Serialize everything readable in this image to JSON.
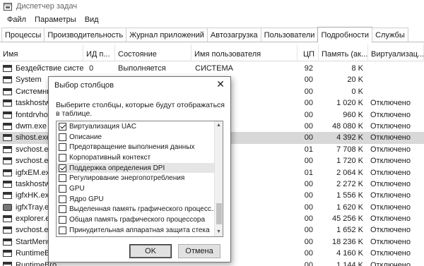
{
  "window": {
    "title": "Диспетчер задач"
  },
  "menu": [
    "Файл",
    "Параметры",
    "Вид"
  ],
  "tabs": [
    "Процессы",
    "Производительность",
    "Журнал приложений",
    "Автозагрузка",
    "Пользователи",
    "Подробности",
    "Службы"
  ],
  "active_tab": "Подробности",
  "columns": {
    "name": "Имя",
    "pid": "ИД п...",
    "status": "Состояние",
    "user": "Имя пользователя",
    "cpu": "ЦП",
    "memory": "Память (ак...",
    "virtualization": "Виртуализац..."
  },
  "rows": [
    {
      "name": "Бездействие системы",
      "pid": "0",
      "status": "Выполняется",
      "user": "СИСТЕМА",
      "cpu": "92",
      "memory": "8 K",
      "virt": ""
    },
    {
      "name": "System",
      "pid": "",
      "status": "",
      "user": "",
      "cpu": "00",
      "memory": "20 K",
      "virt": ""
    },
    {
      "name": "Системные...",
      "pid": "",
      "status": "",
      "user": "",
      "cpu": "00",
      "memory": "0 K",
      "virt": ""
    },
    {
      "name": "taskhostw.exe",
      "pid": "",
      "status": "",
      "user": "",
      "cpu": "00",
      "memory": "1 020 K",
      "virt": "Отключено"
    },
    {
      "name": "fontdrvhost...",
      "pid": "",
      "status": "",
      "user": "",
      "cpu": "00",
      "memory": "960 K",
      "virt": "Отключено"
    },
    {
      "name": "dwm.exe",
      "pid": "",
      "status": "",
      "user": "",
      "cpu": "00",
      "memory": "48 080 K",
      "virt": "Отключено"
    },
    {
      "name": "sihost.exe",
      "pid": "",
      "status": "",
      "user": "",
      "cpu": "00",
      "memory": "4 392 K",
      "virt": "Отключено"
    },
    {
      "name": "svchost.exe",
      "pid": "",
      "status": "",
      "user": "",
      "cpu": "01",
      "memory": "7 708 K",
      "virt": "Отключено"
    },
    {
      "name": "svchost.exe",
      "pid": "",
      "status": "",
      "user": "",
      "cpu": "00",
      "memory": "1 720 K",
      "virt": "Отключено"
    },
    {
      "name": "igfxEM.exe",
      "pid": "",
      "status": "",
      "user": "",
      "cpu": "01",
      "memory": "2 064 K",
      "virt": "Отключено"
    },
    {
      "name": "taskhostw.exe",
      "pid": "",
      "status": "",
      "user": "",
      "cpu": "00",
      "memory": "2 272 K",
      "virt": "Отключено"
    },
    {
      "name": "igfxHK.exe",
      "pid": "",
      "status": "",
      "user": "",
      "cpu": "00",
      "memory": "1 556 K",
      "virt": "Отключено"
    },
    {
      "name": "igfxTray.exe",
      "pid": "",
      "status": "",
      "user": "",
      "cpu": "00",
      "memory": "1 620 K",
      "virt": "Отключено"
    },
    {
      "name": "explorer.exe",
      "pid": "",
      "status": "",
      "user": "",
      "cpu": "00",
      "memory": "45 256 K",
      "virt": "Отключено"
    },
    {
      "name": "svchost.exe",
      "pid": "",
      "status": "",
      "user": "",
      "cpu": "00",
      "memory": "1 652 K",
      "virt": "Отключено"
    },
    {
      "name": "StartMenuE...",
      "pid": "",
      "status": "",
      "user": "",
      "cpu": "00",
      "memory": "18 236 K",
      "virt": "Отключено"
    },
    {
      "name": "RuntimeBro...",
      "pid": "",
      "status": "",
      "user": "",
      "cpu": "00",
      "memory": "4 160 K",
      "virt": "Отключено"
    },
    {
      "name": "RuntimeBro...",
      "pid": "",
      "status": "",
      "user": "",
      "cpu": "00",
      "memory": "1 144 K",
      "virt": "Отключено"
    }
  ],
  "selected_row": 6,
  "dialog": {
    "title": "Выбор столбцов",
    "close_glyph": "✕",
    "description": "Выберите столбцы, которые будут отображаться в таблице.",
    "items": [
      {
        "label": "Виртуализация UAC",
        "checked": true
      },
      {
        "label": "Описание",
        "checked": false
      },
      {
        "label": "Предотвращение выполнения данных",
        "checked": false
      },
      {
        "label": "Корпоративный контекст",
        "checked": false
      },
      {
        "label": "Поддержка определения DPI",
        "checked": true
      },
      {
        "label": "Регулирование энергопотребления",
        "checked": false
      },
      {
        "label": "GPU",
        "checked": false
      },
      {
        "label": "Ядро GPU",
        "checked": false
      },
      {
        "label": "Выделенная память графического процесс...",
        "checked": false
      },
      {
        "label": "Общая память графического процессора",
        "checked": false
      },
      {
        "label": "Принудительная аппаратная защита стека",
        "checked": false
      }
    ],
    "highlighted_item": 4,
    "ok_label": "OK",
    "cancel_label": "Отмена"
  }
}
